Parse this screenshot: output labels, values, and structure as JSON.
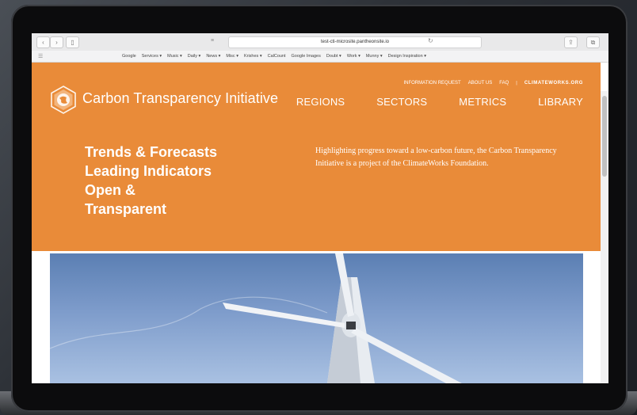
{
  "browser": {
    "url": "test-cti-microsite.pantheonsite.io",
    "bookmarks": [
      "Google",
      "Services ▾",
      "Music ▾",
      "Daily ▾",
      "News ▾",
      "Misc ▾",
      "Krishes ▾",
      "CalCount",
      "Google Images",
      "Doubt ▾",
      "Work ▾",
      "Munny ▾",
      "Design Inspiration ▾"
    ]
  },
  "site": {
    "brand": "Carbon Transparency Initiative",
    "utility_nav": [
      "INFORMATION REQUEST",
      "ABOUT US",
      "FAQ",
      "CLIMATEWORKS.ORG"
    ],
    "main_nav": [
      "REGIONS",
      "SECTORS",
      "METRICS",
      "LIBRARY"
    ],
    "headline": [
      "Trends & Forecasts",
      "Leading Indicators",
      "Open &",
      "Transparent"
    ],
    "blurb": "Highlighting progress toward a low-carbon future, the Carbon Transparency Initiative is a project of the ClimateWorks Foundation.",
    "colors": {
      "accent": "#e98b39"
    }
  },
  "icons": [
    "back-icon",
    "forward-icon",
    "sidebar-icon",
    "reader-icon",
    "reload-icon",
    "share-icon",
    "tabs-icon",
    "logo-icon"
  ]
}
